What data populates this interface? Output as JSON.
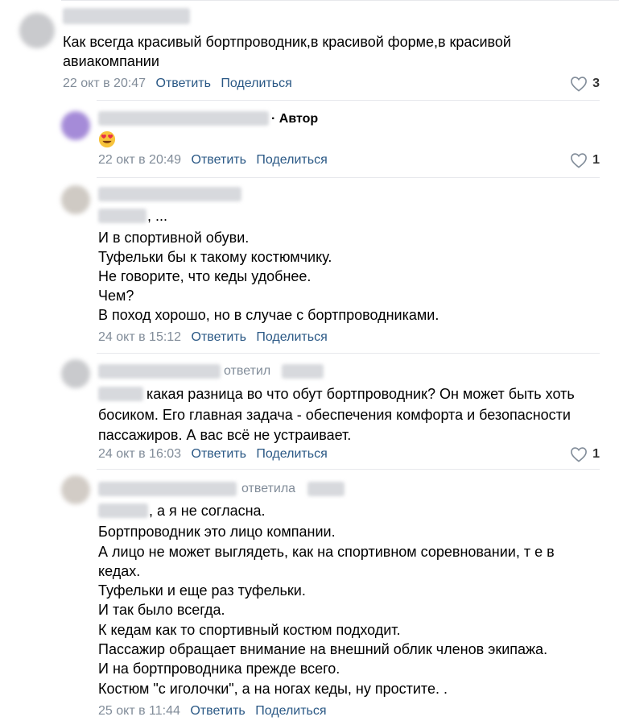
{
  "comments": [
    {
      "text": [
        "Как всегда красивый бортпроводник,в красивой форме,в красивой",
        "авиакомпании"
      ],
      "date": "22 окт в 20:47",
      "reply": "Ответить",
      "share": "Поделиться",
      "likes": "3"
    },
    {
      "author_badge": "· Автор",
      "emoji": "heart-eyes-emoji",
      "date": "22 окт в 20:49",
      "reply": "Ответить",
      "share": "Поделиться",
      "likes": "1"
    },
    {
      "lead": ", ...",
      "text": [
        "И в спортивной обуви.",
        "Туфельки бы к такому костюмчику.",
        "Не говорите, что кеды удобнее.",
        "Чем?",
        "В поход хорошо, но в случае с бортпроводниками."
      ],
      "date": "24 окт в 15:12",
      "reply": "Ответить",
      "share": "Поделиться"
    },
    {
      "replied": "ответил",
      "lead": "какая разница во что обут бортпроводник? Он может быть хоть",
      "text": [
        "босиком. Его главная задача - обеспечения комфорта и безопасности",
        "пассажиров. А вас всё не устраивает."
      ],
      "date": "24 окт в 16:03",
      "reply": "Ответить",
      "share": "Поделиться",
      "likes": "1"
    },
    {
      "replied": "ответила",
      "lead": ", а я не согласна.",
      "text": [
        "Бортпроводник это лицо компании.",
        "А лицо не может выглядеть, как на спортивном соревновании, т е в",
        "кедах.",
        "Туфельки и еще раз туфельки.",
        "И так было всегда.",
        "К кедам как то спортивный костюм подходит.",
        "Пассажир обращает внимание на внешний облик членов экипажа.",
        "И на бортпроводника прежде всего.",
        "Костюм \"с иголочки\", а на ногах кеды, ну простите. ."
      ],
      "date": "25 окт в 11:44",
      "reply": "Ответить",
      "share": "Поделиться"
    }
  ],
  "colors": {
    "link": "#2a5885",
    "meta": "#818c99",
    "divider": "#e7e8ec",
    "redacted": "#d7d9dd"
  },
  "icons": {
    "like": "heart-outline-icon"
  }
}
